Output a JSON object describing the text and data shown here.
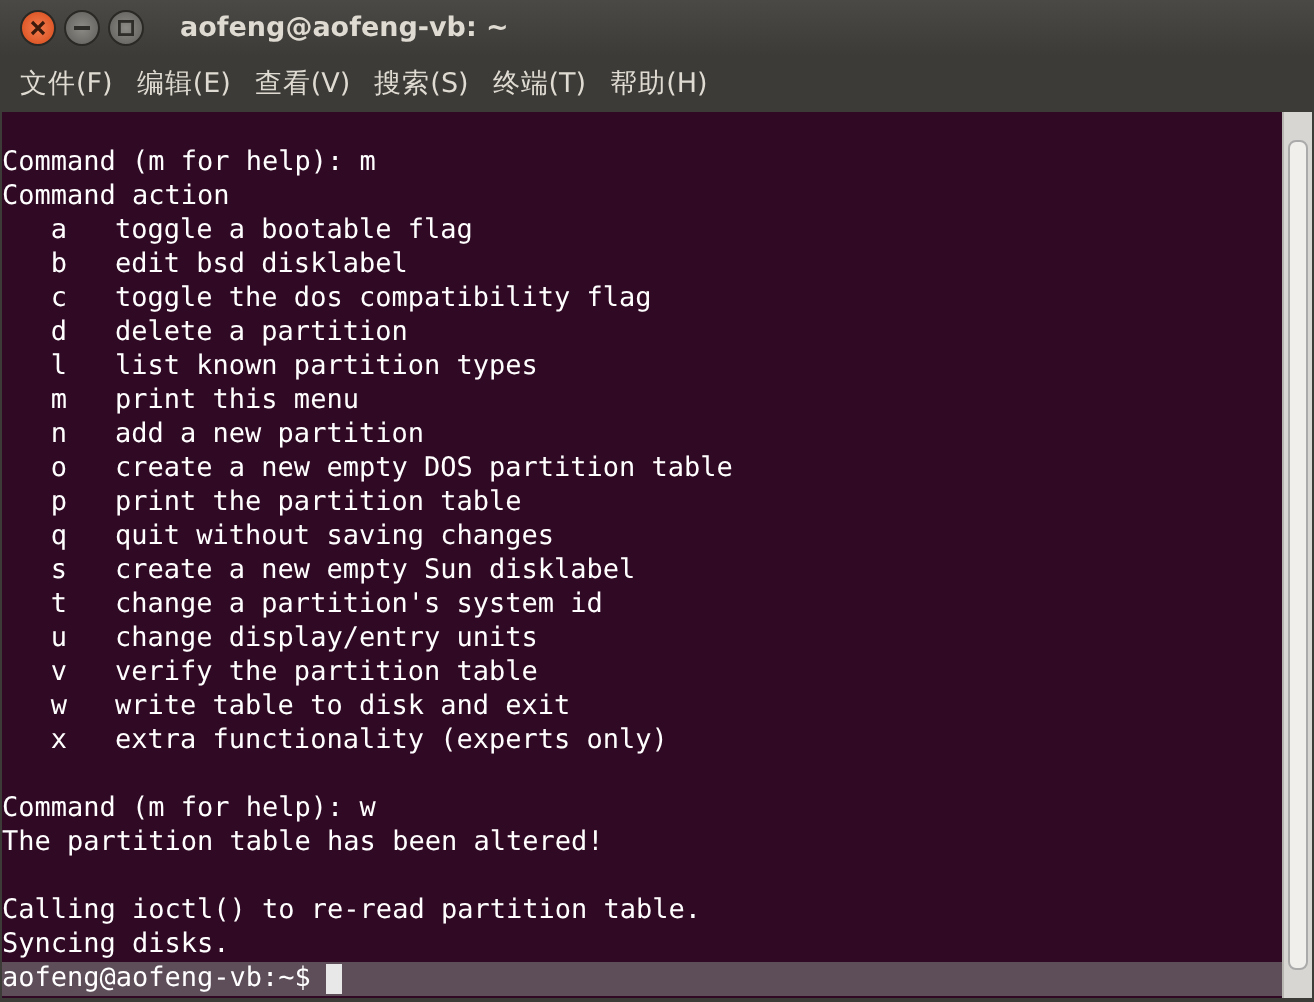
{
  "window": {
    "title": "aofeng@aofeng-vb: ~"
  },
  "menu": [
    "文件(F)",
    "编辑(E)",
    "查看(V)",
    "搜索(S)",
    "终端(T)",
    "帮助(H)"
  ],
  "lines": [
    {
      "kind": "blank"
    },
    {
      "kind": "text",
      "text": "Command (m for help): m"
    },
    {
      "kind": "text",
      "text": "Command action"
    },
    {
      "kind": "option",
      "key": "a",
      "description": "toggle a bootable flag"
    },
    {
      "kind": "option",
      "key": "b",
      "description": "edit bsd disklabel"
    },
    {
      "kind": "option",
      "key": "c",
      "description": "toggle the dos compatibility flag"
    },
    {
      "kind": "option",
      "key": "d",
      "description": "delete a partition"
    },
    {
      "kind": "option",
      "key": "l",
      "description": "list known partition types"
    },
    {
      "kind": "option",
      "key": "m",
      "description": "print this menu"
    },
    {
      "kind": "option",
      "key": "n",
      "description": "add a new partition"
    },
    {
      "kind": "option",
      "key": "o",
      "description": "create a new empty DOS partition table"
    },
    {
      "kind": "option",
      "key": "p",
      "description": "print the partition table"
    },
    {
      "kind": "option",
      "key": "q",
      "description": "quit without saving changes"
    },
    {
      "kind": "option",
      "key": "s",
      "description": "create a new empty Sun disklabel"
    },
    {
      "kind": "option",
      "key": "t",
      "description": "change a partition's system id"
    },
    {
      "kind": "option",
      "key": "u",
      "description": "change display/entry units"
    },
    {
      "kind": "option",
      "key": "v",
      "description": "verify the partition table"
    },
    {
      "kind": "option",
      "key": "w",
      "description": "write table to disk and exit"
    },
    {
      "kind": "option",
      "key": "x",
      "description": "extra functionality (experts only)"
    },
    {
      "kind": "blank"
    },
    {
      "kind": "text",
      "text": "Command (m for help): w"
    },
    {
      "kind": "text",
      "text": "The partition table has been altered!"
    },
    {
      "kind": "blank"
    },
    {
      "kind": "text",
      "text": "Calling ioctl() to re-read partition table."
    },
    {
      "kind": "text",
      "text": "Syncing disks."
    },
    {
      "kind": "prompt",
      "text": "aofeng@aofeng-vb:~$"
    }
  ]
}
